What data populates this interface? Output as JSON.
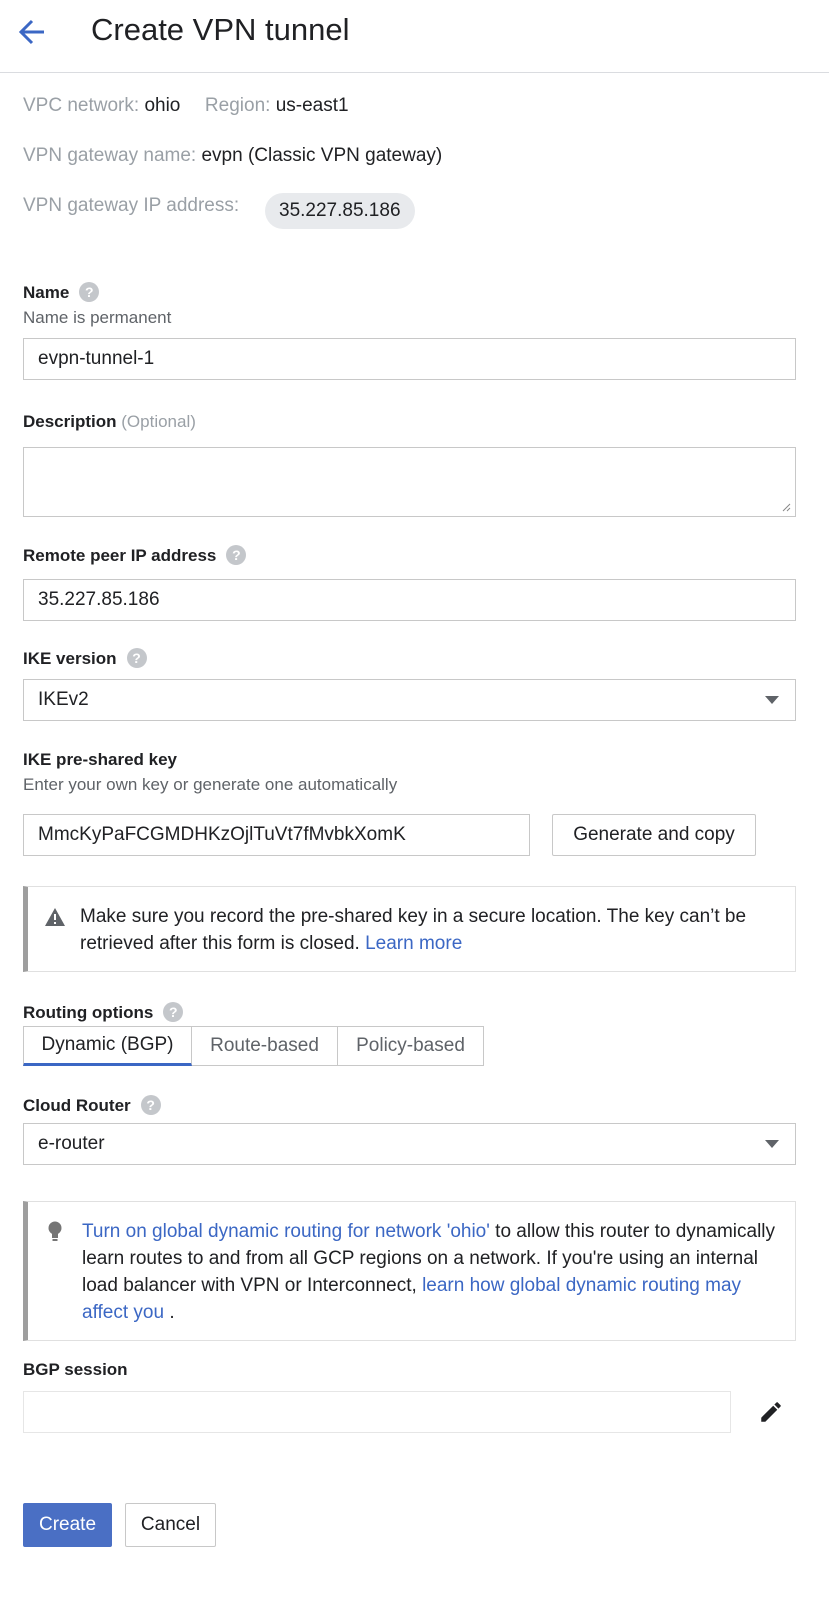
{
  "header": {
    "title": "Create VPN tunnel"
  },
  "info": {
    "vpc_label": "VPC network:",
    "vpc_value": "ohio",
    "region_label": "Region:",
    "region_value": "us-east1",
    "gw_name_label": "VPN gateway name:",
    "gw_name_value": "evpn (Classic VPN gateway)",
    "gw_ip_label": "VPN gateway IP address:",
    "gw_ip_value": "35.227.85.186"
  },
  "name": {
    "label": "Name",
    "help": "?",
    "sub": "Name is permanent",
    "value": "evpn-tunnel-1"
  },
  "description": {
    "label": "Description",
    "optional": "(Optional)",
    "value": ""
  },
  "remote_peer": {
    "label": "Remote peer IP address",
    "help": "?",
    "value": "35.227.85.186"
  },
  "ike_version": {
    "label": "IKE version",
    "help": "?",
    "value": "IKEv2"
  },
  "psk": {
    "label": "IKE pre-shared key",
    "sub": "Enter your own key or generate one automatically",
    "value": "MmcKyPaFCGMDHKzOjlTuVt7fMvbkXomK",
    "generate_label": "Generate and copy"
  },
  "warning": {
    "text": "Make sure you record the pre-shared key in a secure location. The key can’t be retrieved after this form is closed.",
    "link": "Learn more"
  },
  "routing": {
    "label": "Routing options",
    "help": "?",
    "options": [
      "Dynamic (BGP)",
      "Route-based",
      "Policy-based"
    ],
    "selected": "Dynamic (BGP)"
  },
  "cloud_router": {
    "label": "Cloud Router",
    "help": "?",
    "value": "e-router"
  },
  "tip": {
    "link1": "Turn on global dynamic routing for network 'ohio'",
    "text1": " to allow this router to dynamically learn routes to and from all GCP regions on a network. If you're using an internal load balancer with VPN or Interconnect, ",
    "link2": "learn how global dynamic routing may affect you",
    "text2": " ."
  },
  "bgp": {
    "label": "BGP session",
    "value": ""
  },
  "footer": {
    "create_label": "Create",
    "cancel_label": "Cancel"
  },
  "icons": {
    "back": "arrow-back-icon",
    "help": "help-circle-icon",
    "dropdown": "triangle-down-icon",
    "warning": "warning-triangle-icon",
    "tip": "lightbulb-icon",
    "edit": "pencil-icon"
  },
  "colors": {
    "primary": "#4a6fc4",
    "link": "#3b67c4",
    "label_gray": "#9aa0a6",
    "border": "#c8c8c8"
  }
}
